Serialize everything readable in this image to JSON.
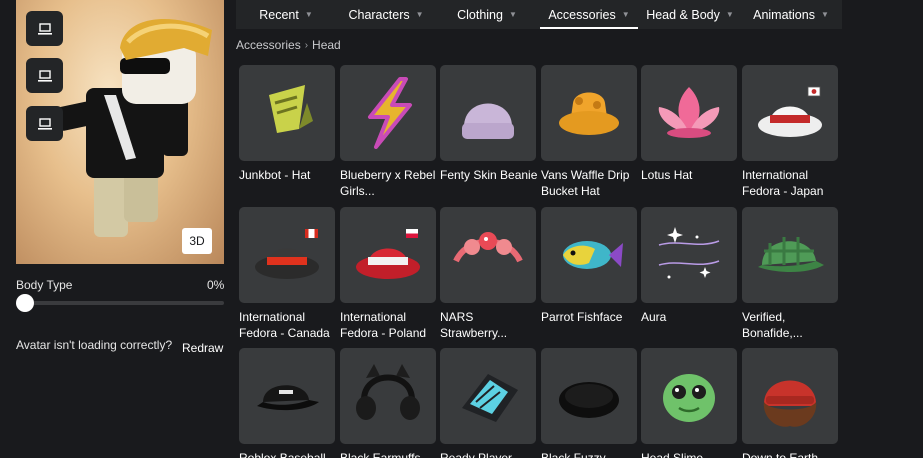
{
  "left_panel": {
    "view_3d_label": "3D",
    "body_type_label": "Body Type",
    "body_type_value": "0%",
    "body_type_fraction": 0,
    "loading_message": "Avatar isn't loading correctly?",
    "redraw_label": "Redraw"
  },
  "tabs": [
    {
      "label": "Recent",
      "active": false
    },
    {
      "label": "Characters",
      "active": false
    },
    {
      "label": "Clothing",
      "active": false
    },
    {
      "label": "Accessories",
      "active": true
    },
    {
      "label": "Head & Body",
      "active": false
    },
    {
      "label": "Animations",
      "active": false
    }
  ],
  "breadcrumb": [
    "Accessories",
    "Head"
  ],
  "items": [
    {
      "name": "Junkbot - Hat",
      "icon": "junkbot-hat-icon"
    },
    {
      "name": "Blueberry x Rebel Girls...",
      "icon": "lightning-bolt-icon"
    },
    {
      "name": "Fenty Skin Beanie",
      "icon": "beanie-icon"
    },
    {
      "name": "Vans Waffle Drip Bucket Hat",
      "icon": "bucket-hat-icon"
    },
    {
      "name": "Lotus Hat",
      "icon": "lotus-icon"
    },
    {
      "name": "International Fedora - Japan",
      "icon": "fedora-japan-icon"
    },
    {
      "name": "International Fedora - Canada",
      "icon": "fedora-canada-icon"
    },
    {
      "name": "International Fedora - Poland",
      "icon": "fedora-poland-icon"
    },
    {
      "name": "NARS Strawberry...",
      "icon": "strawberry-headband-icon"
    },
    {
      "name": "Parrot Fishface",
      "icon": "parrot-fish-icon"
    },
    {
      "name": "Aura",
      "icon": "sparkle-aura-icon"
    },
    {
      "name": "Verified, Bonafide,...",
      "icon": "plaid-cap-icon"
    },
    {
      "name": "Roblox Baseball...",
      "icon": "baseball-cap-icon"
    },
    {
      "name": "Black Earmuffs...",
      "icon": "earmuffs-icon"
    },
    {
      "name": "Ready Player...",
      "icon": "ready-player-hat-icon"
    },
    {
      "name": "Black Fuzzy...",
      "icon": "fuzzy-hat-icon"
    },
    {
      "name": "Head Slime...",
      "icon": "slime-head-icon"
    },
    {
      "name": "Down to Earth...",
      "icon": "hair-beanie-icon"
    }
  ]
}
